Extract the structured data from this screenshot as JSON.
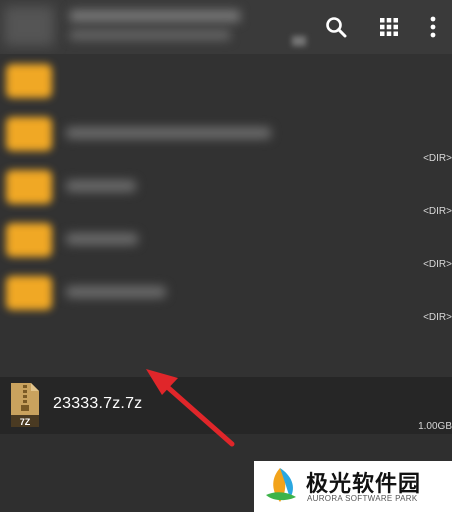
{
  "toolbar": {
    "icons": [
      "search-icon",
      "grid-view-icon",
      "more-vert-icon"
    ]
  },
  "list": {
    "dir_label": "<DIR>",
    "file": {
      "name": "23333.7z.7z",
      "type_badge": "7Z",
      "size": "1.00GB"
    }
  },
  "watermark": {
    "title": "极光软件园",
    "subtitle": "AURORA SOFTWARE PARK"
  },
  "colors": {
    "background": "#2f2f2f",
    "toolbar": "#3a3a3a",
    "folder": "#f0a825",
    "arrow": "#e0262a"
  }
}
